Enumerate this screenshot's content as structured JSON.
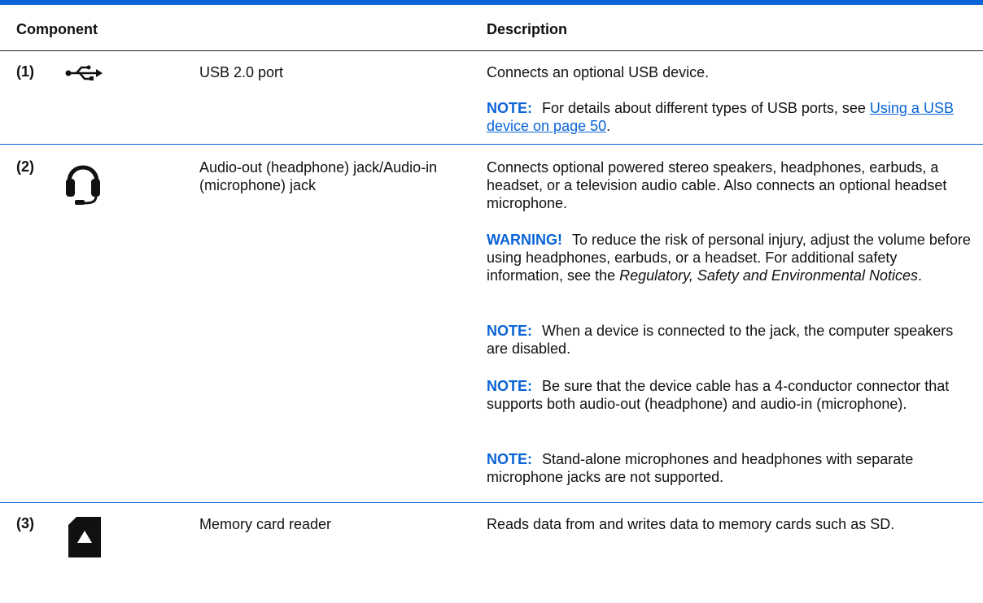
{
  "header": {
    "component": "Component",
    "description": "Description"
  },
  "rows": [
    {
      "number": "(1)",
      "icon": "usb-icon",
      "component": "USB 2.0 port",
      "description": "Connects an optional USB device.",
      "note1_label": "NOTE:",
      "note1_text": "For details about different types of USB ports, see",
      "note1_link": "Using a USB device on page 50",
      "note1_after": "."
    },
    {
      "number": "(2)",
      "icon": "headset-icon",
      "component": "Audio-out (headphone) jack/Audio-in (microphone) jack",
      "description": "Connects optional powered stereo speakers, headphones, earbuds, a headset, or a television audio cable. Also connects an optional headset microphone.",
      "warning_label": "WARNING!",
      "warning_text": "To reduce the risk of personal injury, adjust the volume before using headphones, earbuds, or a headset. For additional safety information, see the",
      "warning_italic": "Regulatory, Safety and Environmental Notices",
      "warning_after": ".",
      "note2_label": "NOTE:",
      "note2_text": "When a device is connected to the jack, the computer speakers are disabled.",
      "note3_label": "NOTE:",
      "note3_text": "Be sure that the device cable has a 4-conductor connector that supports both audio-out (headphone) and audio-in (microphone).",
      "note4_label": "NOTE:",
      "note4_text": "Stand-alone microphones and headphones with separate microphone jacks are not supported."
    },
    {
      "number": "(3)",
      "icon": "memory-card-icon",
      "component": "Memory card reader",
      "description": "Reads data from and writes data to memory cards such as SD."
    }
  ],
  "colors": {
    "accent": "#0a64d7",
    "text": "#111111"
  }
}
